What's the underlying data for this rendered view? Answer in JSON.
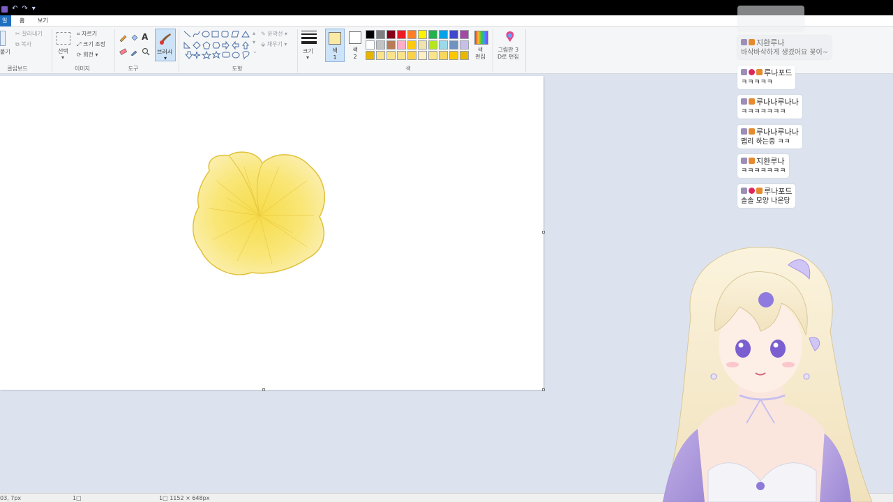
{
  "tabs": {
    "file": "일",
    "home": "홈",
    "view": "보기"
  },
  "ribbon": {
    "clipboard": {
      "paste_label": "붙기",
      "cut_label": "잘라내기",
      "copy_label": "복사",
      "group_label": "클립보드"
    },
    "image": {
      "select_label": "선택",
      "crop_label": "자르기",
      "resize_label": "크기 조정",
      "rotate_label": "회전 ▾",
      "group_label": "이미지"
    },
    "tools": {
      "group_label": "도구"
    },
    "brushes": {
      "label": "브러시"
    },
    "shapes": {
      "outline_label": "윤곽선 ▾",
      "fill_label": "채우기 ▾",
      "group_label": "도형"
    },
    "size": {
      "label": "크기"
    },
    "colors": {
      "color1_label": "색\n1",
      "color2_label": "색\n2",
      "edit_label": "색\n편집",
      "paint3d_label": "그림판 3\nD로 편집",
      "group_label": "색",
      "color1_hex": "#fbeaa4",
      "color2_hex": "#ffffff",
      "palette": [
        "#000000",
        "#7f7f7f",
        "#880015",
        "#ed1c24",
        "#ff7f27",
        "#fff200",
        "#22b14c",
        "#00a2e8",
        "#3f48cc",
        "#a349a4",
        "#ffffff",
        "#c3c3c3",
        "#b97a57",
        "#ffaec9",
        "#ffc90e",
        "#efe4b0",
        "#b5e61d",
        "#99d9ea",
        "#7092be",
        "#c8bfe7",
        "#e6b500",
        "#fbe38a",
        "#fbe38a",
        "#fbe38a",
        "#f9d14a",
        "#fdf0c4",
        "#fbe38a",
        "#f8d75c",
        "#fbc800",
        "#e8b800"
      ]
    }
  },
  "status": {
    "cursor_pos": "03, 7px",
    "selection_icon": "1□",
    "canvas_size": "1□ 1152 × 648px"
  },
  "chat": [
    {
      "user": "지환루나",
      "text": "바삭바삭하게 생겼어요 꽃이~",
      "badges": [
        "grey",
        "car"
      ],
      "faded": true
    },
    {
      "user": "루나포드",
      "text": "ㅋㅋㅋㅋㅋ",
      "badges": [
        "grey",
        "heart",
        "car"
      ],
      "faded": false
    },
    {
      "user": "루나나루나나",
      "text": "ㅋㅋㅋㅋㅋㅋㅋ",
      "badges": [
        "grey",
        "car"
      ],
      "faded": false
    },
    {
      "user": "루나나루나나",
      "text": "맵리 하는중 ㅋㅋ",
      "badges": [
        "grey",
        "car"
      ],
      "faded": false
    },
    {
      "user": "지환루나",
      "text": "ㅋㅋㅋㅋㅋㅋㅋ",
      "badges": [
        "grey",
        "car"
      ],
      "faded": false
    },
    {
      "user": "루나포드",
      "text": "솔솔 모양 나온당",
      "badges": [
        "grey",
        "heart",
        "car"
      ],
      "faded": false
    }
  ]
}
